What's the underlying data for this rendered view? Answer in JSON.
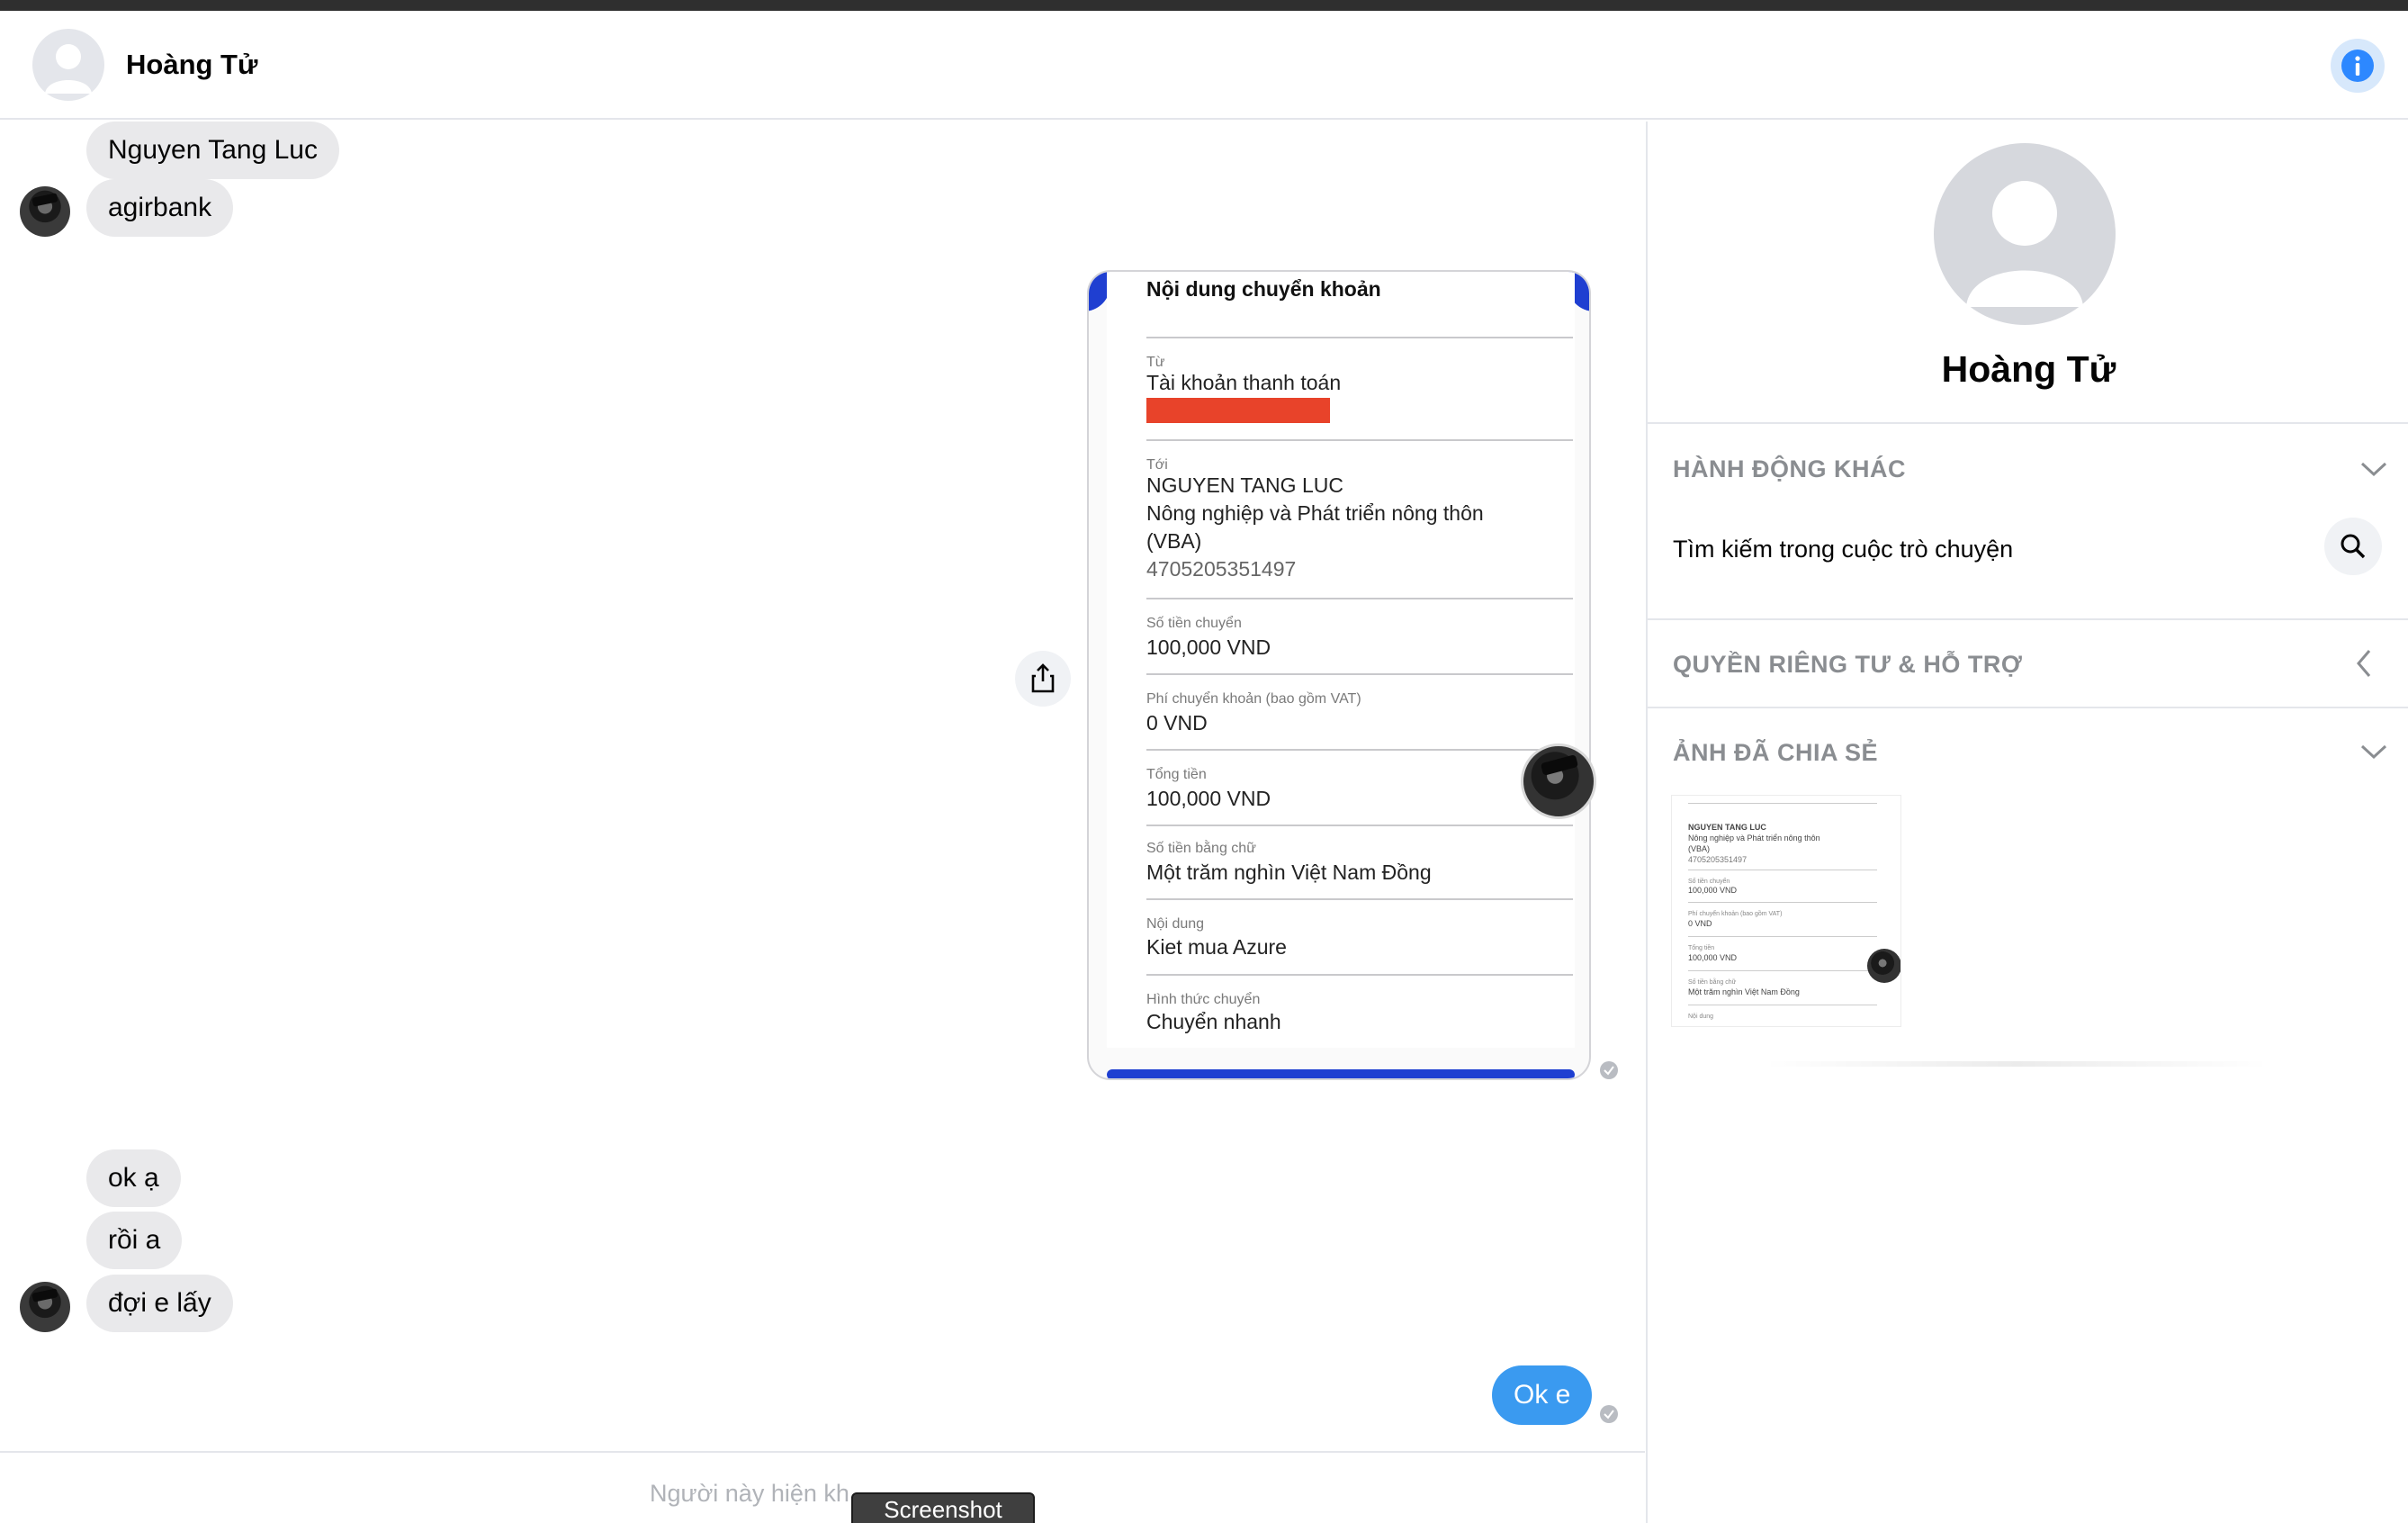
{
  "header": {
    "contact_name": "Hoàng Tử"
  },
  "messages": {
    "incoming_1": "Nguyen Tang Luc",
    "incoming_2": "agirbank",
    "incoming_3": "ok ạ",
    "incoming_4": "rồi a",
    "incoming_5": "đợi e lấy",
    "outgoing_1": "Ok e"
  },
  "receipt": {
    "title": "Nội dung chuyển khoản",
    "from_label": "Từ",
    "from_value": "Tài khoản thanh toán",
    "to_label": "Tới",
    "to_name": "NGUYEN TANG LUC",
    "to_bank_line1": "Nông nghiệp và Phát triển nông thôn",
    "to_bank_line2": "(VBA)",
    "to_account": "4705205351497",
    "amount_label": "Số tiền chuyển",
    "amount_value": "100,000 VND",
    "fee_label": "Phí chuyển khoản (bao gồm VAT)",
    "fee_value": "0 VND",
    "total_label": "Tổng tiền",
    "total_value": "100,000 VND",
    "words_label": "Số tiền bằng chữ",
    "words_value": "Một trăm nghìn Việt Nam Đồng",
    "content_label": "Nội dung",
    "content_value": "Kiet mua Azure",
    "method_label": "Hình thức chuyển",
    "method_value": "Chuyển nhanh"
  },
  "sidebar": {
    "name": "Hoàng Tử",
    "more_actions": "HÀNH ĐỘNG KHÁC",
    "search_in_conversation": "Tìm kiếm trong cuộc trò chuyện",
    "privacy_support": "QUYỀN RIÊNG TƯ & HỖ TRỢ",
    "shared_photos": "ẢNH ĐÃ CHIA SẺ",
    "thumbnail": {
      "line1": "NGUYEN TANG LUC",
      "line2": "Nông nghiệp và Phát triển nông thôn",
      "line3": "(VBA)",
      "line4": "4705205351497",
      "line5": "Số tiền chuyển",
      "line6": "100,000 VND",
      "line7": "Phí chuyển khoản (bao gồm VAT)",
      "line8": "0 VND",
      "line9": "Tổng tiền",
      "line10": "100,000 VND",
      "line11": "Số tiền bằng chữ",
      "line12": "Một trăm nghìn Việt Nam Đồng",
      "line13": "Nội dung"
    }
  },
  "footer": {
    "note": "Người này hiện kh",
    "screenshot_label": "Screenshot"
  },
  "colors": {
    "accent": "#3a9af0",
    "bank_blue": "#1f3fd1",
    "redaction": "#e8432a"
  },
  "icons": {
    "info": "info-icon",
    "share": "share-icon",
    "search": "search-icon",
    "chevron_down": "chevron-down-icon",
    "chevron_left": "chevron-left-icon",
    "seen": "seen-check-icon"
  }
}
